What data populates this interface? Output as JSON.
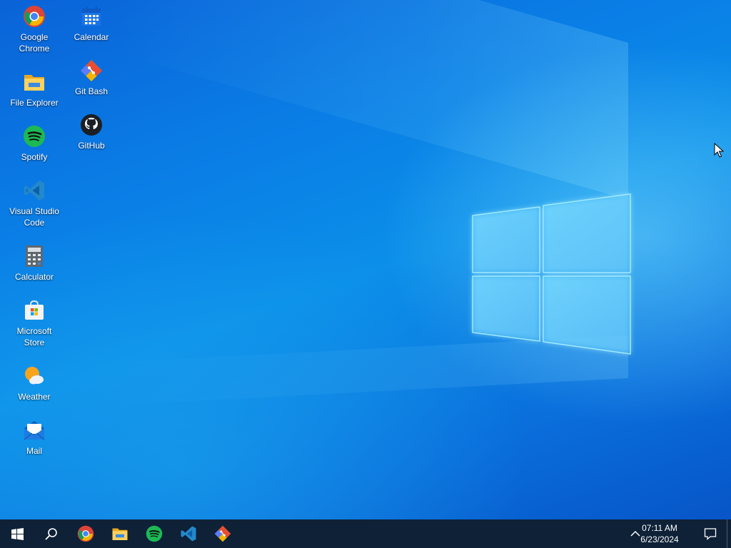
{
  "desktop": {
    "icons": [
      {
        "label": "Google\nChrome",
        "icon": "chrome-icon"
      },
      {
        "label": "File Explorer",
        "icon": "file-explorer-icon"
      },
      {
        "label": "Spotify",
        "icon": "spotify-icon"
      },
      {
        "label": "Visual Studio\nCode",
        "icon": "vscode-icon"
      },
      {
        "label": "Calculator",
        "icon": "calculator-icon"
      },
      {
        "label": "Microsoft\nStore",
        "icon": "store-icon"
      },
      {
        "label": "Weather",
        "icon": "weather-icon"
      },
      {
        "label": "Mail",
        "icon": "mail-icon"
      },
      {
        "label": "Calendar",
        "icon": "calendar-icon"
      },
      {
        "label": "Git Bash",
        "icon": "git-bash-icon"
      },
      {
        "label": "GitHub",
        "icon": "github-icon"
      }
    ]
  },
  "taskbar": {
    "pinned": [
      "start-icon",
      "search-icon",
      "chrome-icon",
      "file-explorer-icon",
      "spotify-icon",
      "vscode-icon",
      "git-bash-icon"
    ],
    "tray": {
      "time": "07:11 AM",
      "date": "6/23/2024",
      "overflow_icon": "chevron-up-icon",
      "notification_icon": "action-center-icon"
    },
    "background": "#0e2137"
  },
  "wallpaper": {
    "accent": "#0a7fe6",
    "logo_glow": "#7fe0ff"
  }
}
